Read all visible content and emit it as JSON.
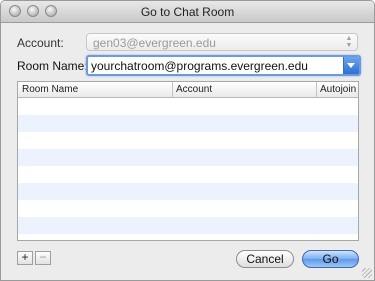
{
  "window": {
    "title": "Go to Chat Room"
  },
  "form": {
    "account_label": "Account:",
    "account_value": "gen03@evergreen.edu",
    "room_label": "Room Name:",
    "room_value": "yourchatroom@programs.evergreen.edu"
  },
  "table": {
    "columns": [
      "Room Name",
      "Account",
      "Autojoin"
    ],
    "rows": []
  },
  "buttons": {
    "add": "+",
    "remove": "−",
    "cancel": "Cancel",
    "go": "Go"
  }
}
